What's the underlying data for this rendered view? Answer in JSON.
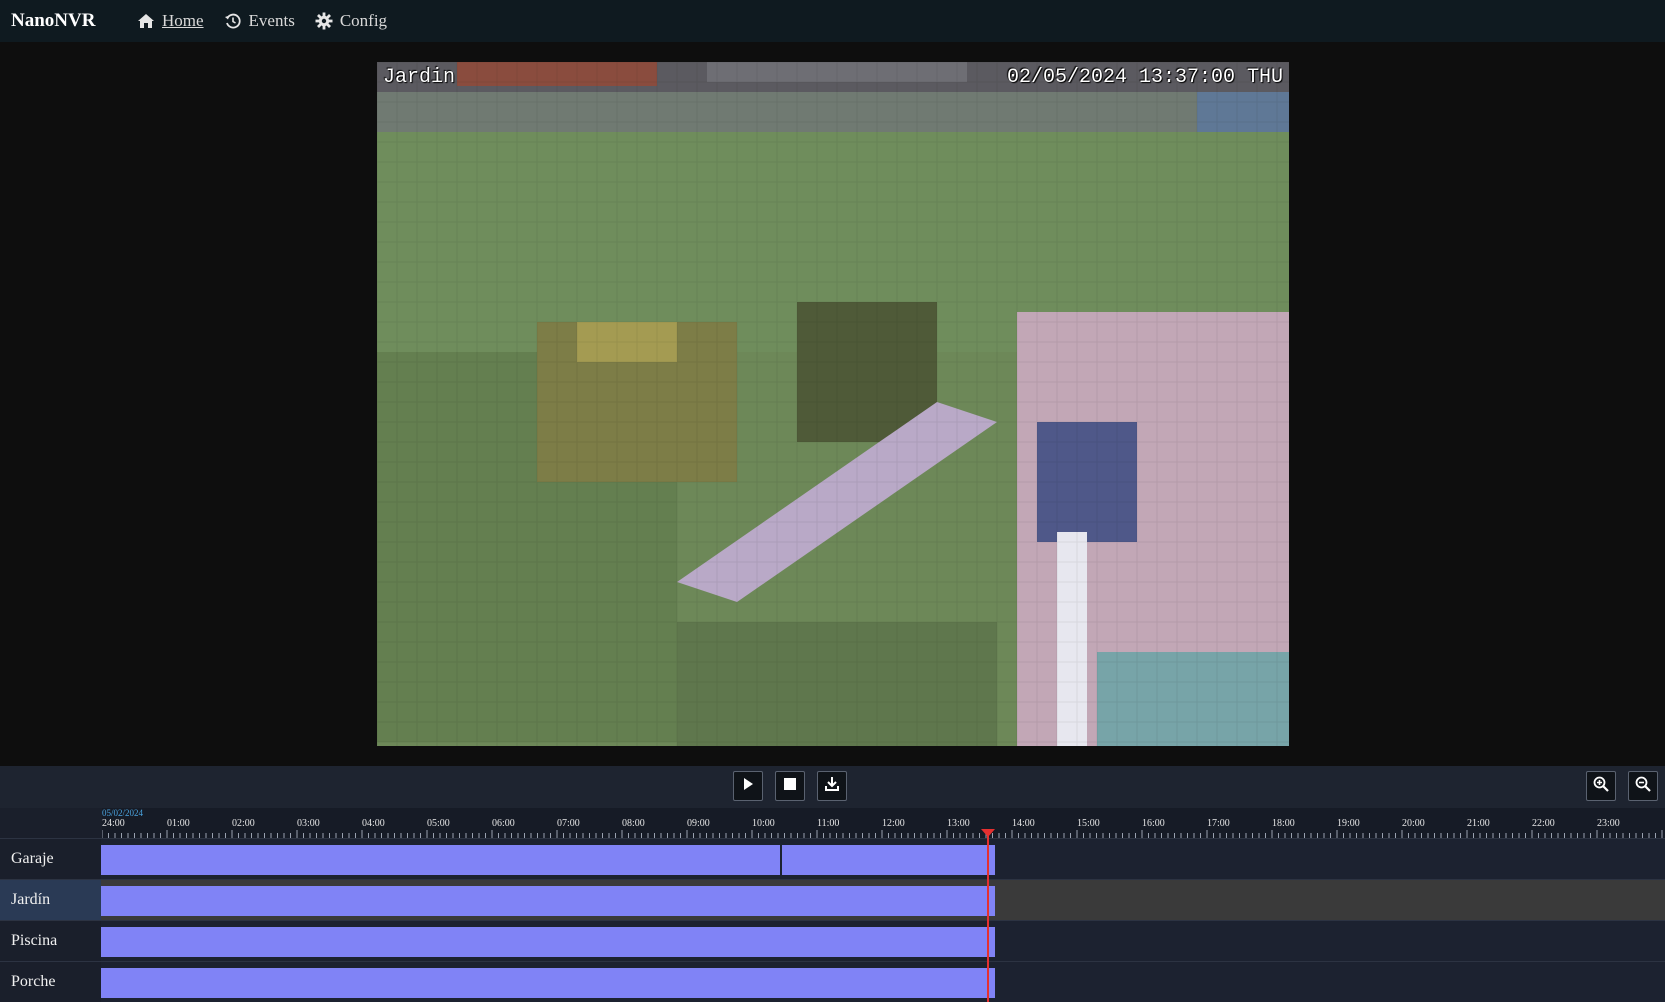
{
  "app": {
    "brand": "NanoNVR"
  },
  "nav": {
    "items": [
      {
        "label": "Home",
        "icon": "home-icon",
        "active": true
      },
      {
        "label": "Events",
        "icon": "history-icon",
        "active": false
      },
      {
        "label": "Config",
        "icon": "gear-icon",
        "active": false
      }
    ]
  },
  "viewer": {
    "camera_overlay": "Jardin",
    "timestamp_overlay": "02/05/2024 13:37:00 THU"
  },
  "controls": {
    "buttons": [
      "play-icon",
      "stop-icon",
      "download-icon"
    ],
    "zoom_buttons": [
      "zoom-in-icon",
      "zoom-out-icon"
    ]
  },
  "timeline": {
    "date": "05/02/2024",
    "hour_labels": [
      "24:00",
      "01:00",
      "02:00",
      "03:00",
      "04:00",
      "05:00",
      "06:00",
      "07:00",
      "08:00",
      "09:00",
      "10:00",
      "11:00",
      "12:00",
      "13:00",
      "14:00",
      "15:00",
      "16:00",
      "17:00",
      "18:00",
      "19:00",
      "20:00",
      "21:00",
      "22:00",
      "23:00"
    ],
    "playhead_time": "13:37",
    "cameras": [
      {
        "name": "Garaje",
        "selected": false
      },
      {
        "name": "Jardín",
        "selected": true
      },
      {
        "name": "Piscina",
        "selected": false
      },
      {
        "name": "Porche",
        "selected": false
      }
    ]
  },
  "colors": {
    "recording": "#8083f6",
    "playhead": "#e53030",
    "date_label": "#4aa3df",
    "navbar": "#0f1a20"
  }
}
